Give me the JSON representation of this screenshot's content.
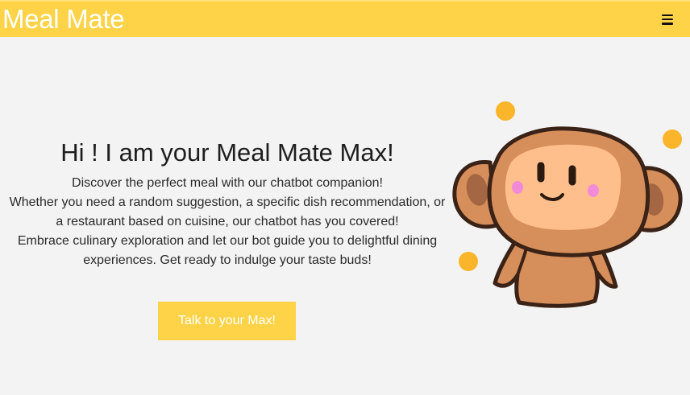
{
  "navbar": {
    "brand": "Meal Mate",
    "menu_icon": "hamburger-menu-icon",
    "background_color": "#ffd347"
  },
  "hero": {
    "title": "Hi ! I am your Meal Mate Max!",
    "lines": [
      "Discover the perfect meal with our chatbot companion!",
      "Whether you need a random suggestion, a specific dish recommendation, or",
      "a restaurant based on cuisine, our chatbot has you covered!",
      "Embrace culinary exploration and let our bot guide you to delightful dining",
      "experiences. Get ready to indulge your taste buds!"
    ],
    "cta_label": "Talk to your Max!",
    "cta_color": "#ffd347"
  },
  "mascot": {
    "icon": "monkey-mascot-icon",
    "body_color": "#d68f5b",
    "face_color": "#ffbf8c",
    "outline_color": "#3a2216",
    "dot_color": "#fbb52b"
  }
}
